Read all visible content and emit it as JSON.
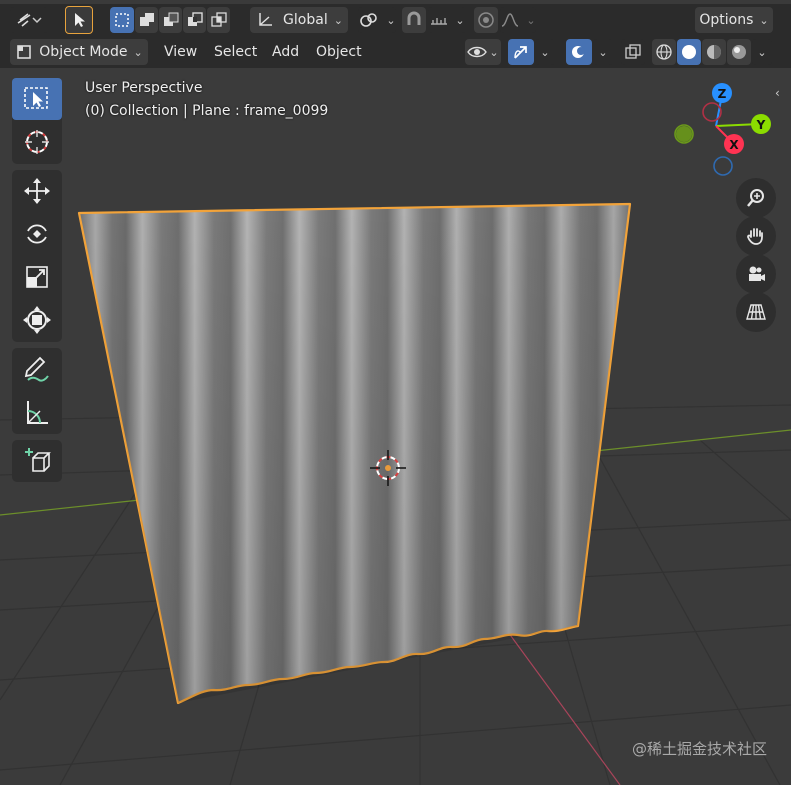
{
  "header": {
    "transform_orientation": "Global",
    "options_label": "Options"
  },
  "menubar": {
    "mode_label": "Object Mode",
    "items": [
      "View",
      "Select",
      "Add",
      "Object"
    ]
  },
  "viewport": {
    "view_name": "User Perspective",
    "status_line": "(0) Collection | Plane : frame_0099"
  },
  "gizmo": {
    "axis_z": "Z",
    "axis_y": "Y",
    "axis_x": "X",
    "color_x": "#ff3352",
    "color_y": "#8bdc00",
    "color_z": "#2890ff"
  },
  "colors": {
    "selection_outline": "#f2a33a",
    "active_button": "#4772b3",
    "x_axis_line": "#a8445a",
    "y_axis_line": "#6c8f2a"
  },
  "tools": [
    "select-box-icon",
    "cursor-icon",
    "move-icon",
    "rotate-icon",
    "scale-icon",
    "transform-icon",
    "annotate-icon",
    "measure-icon",
    "add-cube-icon"
  ],
  "nav_buttons": [
    "zoom-icon",
    "hand-icon",
    "camera-icon",
    "grid-icon"
  ],
  "watermark": "@稀土掘金技术社区"
}
